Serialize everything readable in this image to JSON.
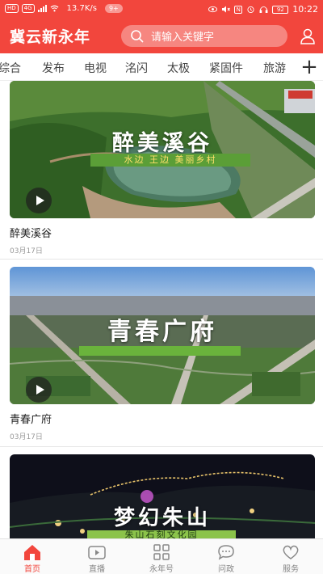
{
  "status_bar": {
    "network_badges": [
      "HD",
      "4G"
    ],
    "speed": "13.7K/s",
    "notif_count": "9+",
    "nfc": "N",
    "battery": "92",
    "time": "10:22"
  },
  "header": {
    "title": "冀云新永年",
    "search_placeholder": "请输入关键字"
  },
  "tabs": [
    {
      "label": "综合"
    },
    {
      "label": "发布"
    },
    {
      "label": "电视"
    },
    {
      "label": "洺闪"
    },
    {
      "label": "太极"
    },
    {
      "label": "紧固件"
    },
    {
      "label": "旅游"
    }
  ],
  "tabs_plus": "+",
  "feed": [
    {
      "title": "醉美溪谷",
      "date": "03月17日",
      "overlay_title": "醉美溪谷",
      "overlay_sub": "水边 王边 美丽乡村"
    },
    {
      "title": "青春广府",
      "date": "03月17日",
      "overlay_title": "青春广府"
    },
    {
      "overlay_title": "梦幻朱山",
      "overlay_sub": "朱山石刻文化园"
    }
  ],
  "bottom_nav": [
    {
      "label": "首页",
      "icon": "home-icon"
    },
    {
      "label": "直播",
      "icon": "video-icon"
    },
    {
      "label": "永年号",
      "icon": "grid-icon"
    },
    {
      "label": "问政",
      "icon": "chat-icon"
    },
    {
      "label": "服务",
      "icon": "heart-icon"
    }
  ],
  "colors": {
    "brand": "#f2463d",
    "active_nav": "#f2463d",
    "inactive_nav": "#888888"
  }
}
